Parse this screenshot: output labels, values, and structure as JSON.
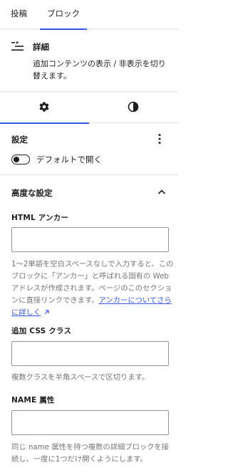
{
  "tabs": {
    "post": "投稿",
    "block": "ブロック"
  },
  "block_card": {
    "title": "詳細",
    "description": "追加コンテンツの表示 / 非表示を切り替えます。"
  },
  "settings": {
    "title": "設定",
    "toggle_label": "デフォルトで開く",
    "toggle_on": false
  },
  "advanced": {
    "title": "高度な設定",
    "html_anchor": {
      "label": "HTML アンカー",
      "value": "",
      "help_text": "1〜2単語を空白スペースなしで入力すると、このブロックに「アンカー」と呼ばれる固有の Web アドレスが作成されます。ページのこのセクションに直接リンクできます。",
      "help_link": "アンカーについてさらに詳しく"
    },
    "css_class": {
      "label": "追加 CSS クラス",
      "value": "",
      "help_text": "複数クラスを半角スペースで区切ります。"
    },
    "name_attr": {
      "label": "NAME 属性",
      "value": "",
      "help_text": "同じ name 属性を持つ複数の詳細ブロックを接続し、一度に1つだけ開くようにします。"
    }
  },
  "colors": {
    "accent": "#3858e9",
    "text": "#1e1e1e",
    "muted": "#757575",
    "border": "#e0e0e0"
  },
  "icons": [
    "details-block-icon",
    "gear-icon",
    "contrast-icon",
    "kebab-menu-icon",
    "chevron-up-icon",
    "external-link-icon"
  ]
}
